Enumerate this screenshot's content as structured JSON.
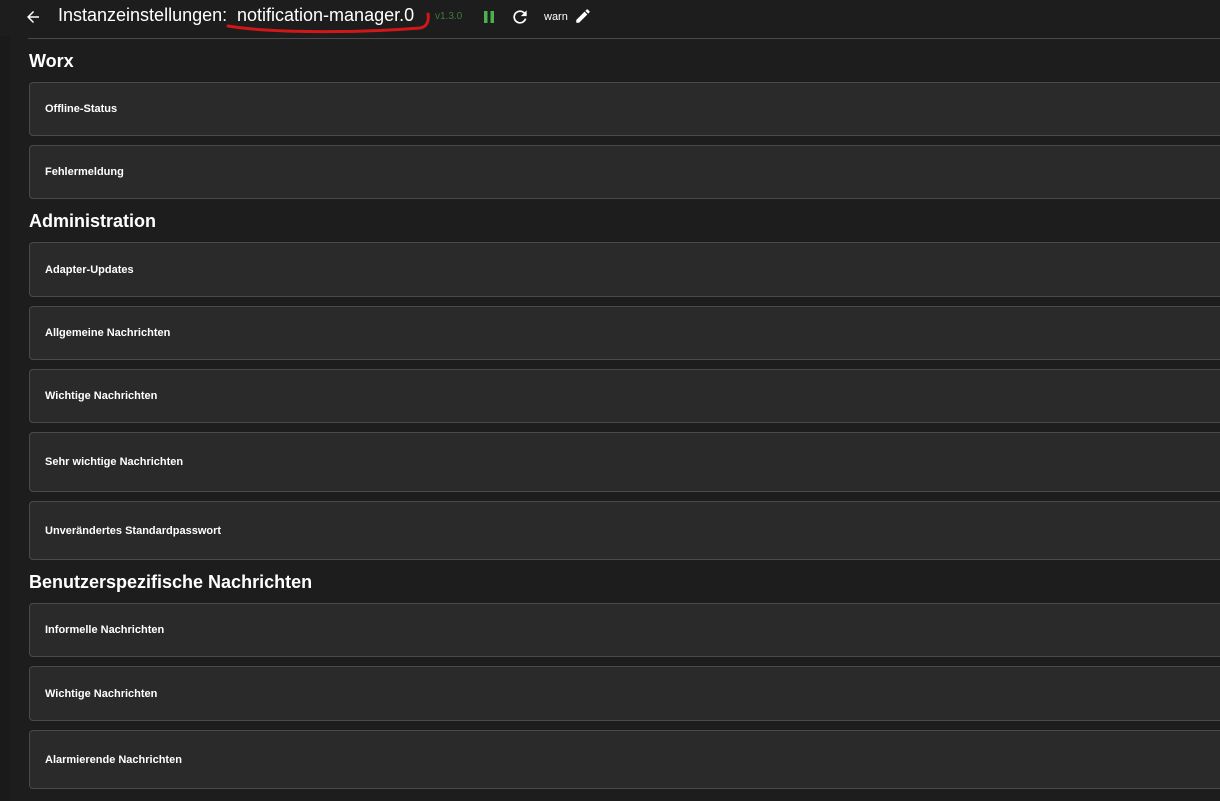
{
  "header": {
    "title_prefix": "Instanzeinstellungen:",
    "instance_name": "notification-manager.0",
    "version": "v1.3.0",
    "log_level": "warn",
    "back_icon": "arrow-left-icon",
    "pause_icon": "pause-icon",
    "refresh_icon": "refresh-icon",
    "edit_icon": "pencil-icon",
    "version_color": "#3f7a3f",
    "pause_color": "#4caf50",
    "annotation_color": "#d01818"
  },
  "sections": [
    {
      "title": "Worx",
      "items": [
        "Offline-Status",
        "Fehlermeldung"
      ]
    },
    {
      "title": "Administration",
      "items": [
        "Adapter-Updates",
        "Allgemeine Nachrichten",
        "Wichtige Nachrichten",
        "Sehr wichtige Nachrichten",
        "Unverändertes Standardpasswort"
      ]
    },
    {
      "title": "Benutzerspezifische Nachrichten",
      "items": [
        "Informelle Nachrichten",
        "Wichtige Nachrichten",
        "Alarmierende Nachrichten"
      ]
    }
  ]
}
